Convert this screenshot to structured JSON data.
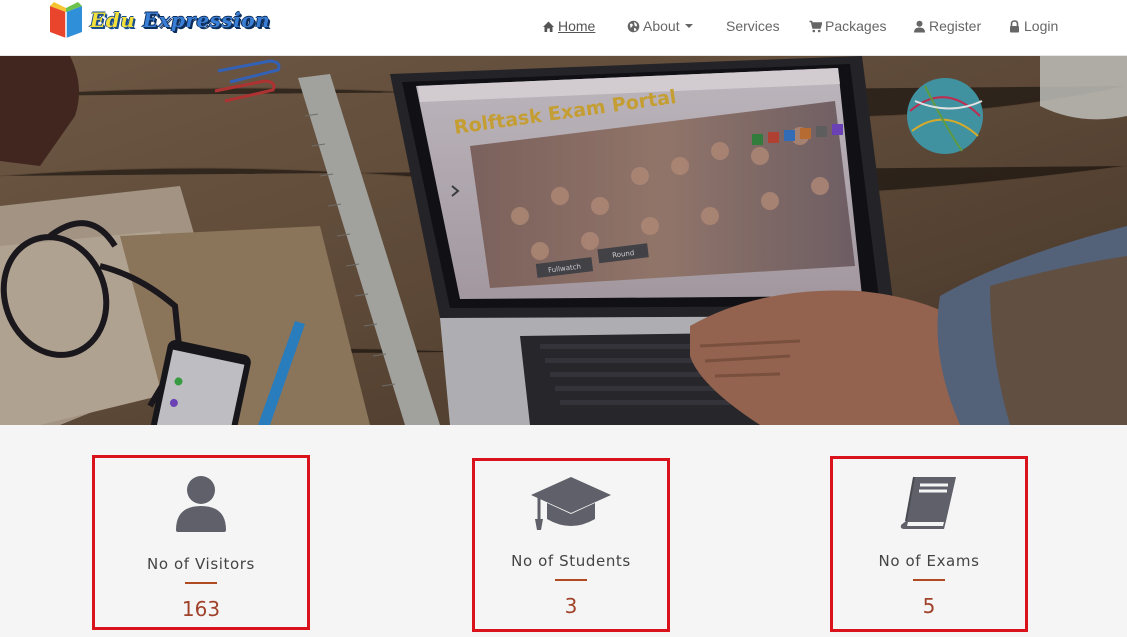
{
  "brand": {
    "word1": "Edu",
    "word2": "Expression",
    "logo_icon": "book-logo-icon"
  },
  "nav": {
    "items": [
      {
        "label": "Home",
        "icon": "home-icon"
      },
      {
        "label": "About",
        "icon": "globe-icon"
      },
      {
        "label": "Services",
        "icon": ""
      },
      {
        "label": "Packages",
        "icon": "cart-icon"
      },
      {
        "label": "Register",
        "icon": "user-icon"
      },
      {
        "label": "Login",
        "icon": "lock-icon"
      }
    ]
  },
  "hero": {
    "laptop_screen": {
      "title": "Rolftask Exam Portal",
      "buttons": [
        "Fullwatch",
        "Round"
      ]
    }
  },
  "stats": [
    {
      "title": "No of Visitors",
      "value": "163",
      "icon": "user-icon"
    },
    {
      "title": "No of Students",
      "value": "3",
      "icon": "graduation-cap-icon"
    },
    {
      "title": "No of Exams",
      "value": "5",
      "icon": "book-icon"
    }
  ],
  "colors": {
    "card_border": "#d9121b",
    "stat_value": "#a0422a",
    "accent_line": "#b04a22",
    "icon": "#5f6069"
  }
}
